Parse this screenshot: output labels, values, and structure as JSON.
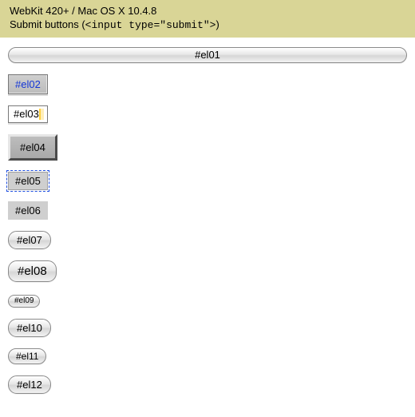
{
  "header": {
    "ua": "WebKit 420+ / Mac OS X 10.4.8",
    "title_prefix": "Submit buttons (",
    "title_code": "<input type=\"submit\">",
    "title_suffix": ")"
  },
  "buttons": {
    "el01": "#el01",
    "el02": "#el02",
    "el03": "#el03",
    "el04": "#el04",
    "el05": "#el05",
    "el06": "#el06",
    "el07": "#el07",
    "el08": "#el08",
    "el09": "#el09",
    "el10": "#el10",
    "el11": "#el11",
    "el12": "#el12"
  }
}
